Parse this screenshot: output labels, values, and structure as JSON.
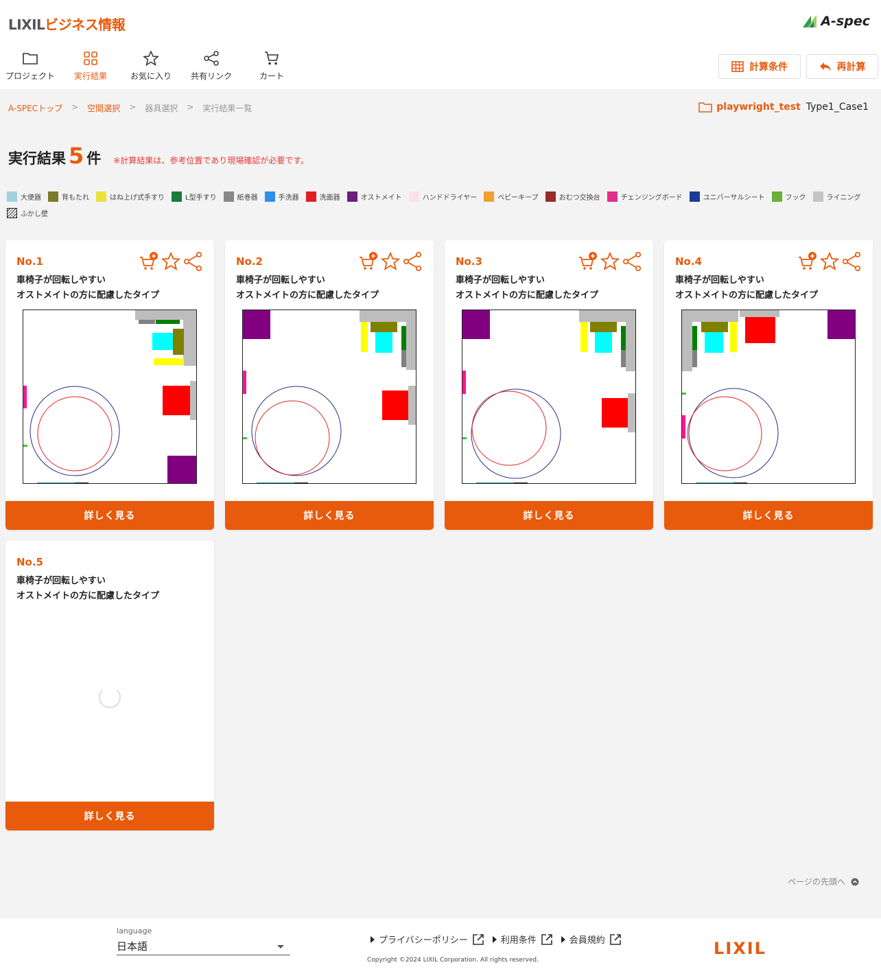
{
  "header": {
    "brand_part1": "LIXIL",
    "brand_part2": "ビジネス情報",
    "app_logo": "A-spec",
    "nav": [
      {
        "label": "プロジェクト",
        "icon": "folder-icon"
      },
      {
        "label": "実行結果",
        "icon": "grid-icon"
      },
      {
        "label": "お気に入り",
        "icon": "star-icon"
      },
      {
        "label": "共有リンク",
        "icon": "share-icon"
      },
      {
        "label": "カート",
        "icon": "cart-icon"
      }
    ],
    "calc_conditions": "計算条件",
    "recalc": "再計算"
  },
  "breadcrumb": {
    "items": [
      "A-SPECトップ",
      "空間選択",
      "器具選択",
      "実行結果一覧"
    ],
    "sep": ">"
  },
  "project": {
    "name": "playwright_test",
    "case": "Type1_Case1"
  },
  "results": {
    "title": "実行結果",
    "count": "5",
    "unit": "件",
    "note": "※計算結果は、参考位置であり現場確認が必要です。"
  },
  "legend": [
    {
      "label": "大便器",
      "color": "#9fd1e0"
    },
    {
      "label": "背もたれ",
      "color": "#7a7a2a"
    },
    {
      "label": "はね上げ式手すり",
      "color": "#e9e33a"
    },
    {
      "label": "L型手すり",
      "color": "#1a7a3a"
    },
    {
      "label": "紙巻器",
      "color": "#888888"
    },
    {
      "label": "手洗器",
      "color": "#2b8ef0"
    },
    {
      "label": "洗面器",
      "color": "#e02020"
    },
    {
      "label": "オストメイト",
      "color": "#6a1f7a"
    },
    {
      "label": "ハンドドライヤー",
      "color": "#fde0e6"
    },
    {
      "label": "ベビーキープ",
      "color": "#f0a030"
    },
    {
      "label": "おむつ交換台",
      "color": "#9a2a2a"
    },
    {
      "label": "チェンジングボード",
      "color": "#e0308a"
    },
    {
      "label": "ユニバーサルシート",
      "color": "#1a3a9a"
    },
    {
      "label": "フック",
      "color": "#6ab03a"
    },
    {
      "label": "ライニング",
      "color": "#c4c4c4"
    },
    {
      "label": "ふかし壁",
      "color": "hatch"
    }
  ],
  "cards": [
    {
      "no": "No.1",
      "line1": "車椅子が回転しやすい",
      "line2": "オストメイトの方に配慮したタイプ",
      "button": "詳しく見る"
    },
    {
      "no": "No.2",
      "line1": "車椅子が回転しやすい",
      "line2": "オストメイトの方に配慮したタイプ",
      "button": "詳しく見る"
    },
    {
      "no": "No.3",
      "line1": "車椅子が回転しやすい",
      "line2": "オストメイトの方に配慮したタイプ",
      "button": "詳しく見る"
    },
    {
      "no": "No.4",
      "line1": "車椅子が回転しやすい",
      "line2": "オストメイトの方に配慮したタイプ",
      "button": "詳しく見る"
    },
    {
      "no": "No.5",
      "line1": "車椅子が回転しやすい",
      "line2": "オストメイトの方に配慮したタイプ",
      "button": "詳しく見る"
    }
  ],
  "back_to_top": "ページの先頭へ",
  "footer": {
    "language_label": "language",
    "language_value": "日本語",
    "links": [
      "プライバシーポリシー",
      "利用条件",
      "会員規約"
    ],
    "copyright": "Copyright ©2024 LIXIL Corporation. All rights reserved.",
    "logo": "LIXIL"
  }
}
